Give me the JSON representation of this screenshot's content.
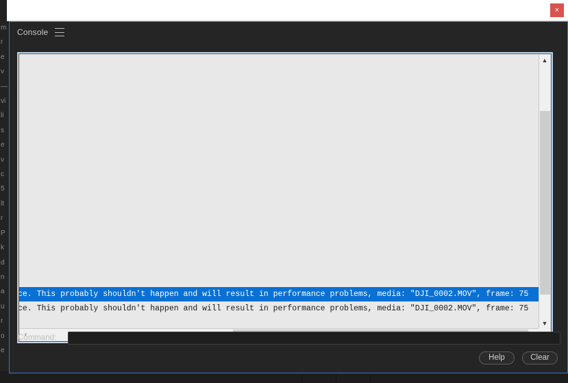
{
  "window": {
    "close_label": "×"
  },
  "panel": {
    "title": "Console",
    "menu_icon": "hamburger-menu-icon"
  },
  "log": {
    "lines": [
      {
        "text": "ce. This probably shouldn't happen and will result in performance problems, media: \"DJI_0002.MOV\", frame: 75",
        "selected": true
      },
      {
        "text": "ce. This probably shouldn't happen and will result in performance problems, media: \"DJI_0002.MOV\", frame: 75",
        "selected": false
      }
    ],
    "scroll_up_icon": "▲",
    "scroll_down_icon": "▼",
    "scroll_left_icon": "‹",
    "scroll_right_icon": "›",
    "selection_color": "#0a70d4",
    "background_color": "#e8e8e8"
  },
  "command": {
    "label": "Command:",
    "value": "",
    "placeholder": ""
  },
  "footer": {
    "help_label": "Help",
    "clear_label": "Clear"
  },
  "backdrop": {
    "left_fragments": "m\nr\ne\nv\n—\nvi\nli\n\ns\ne\nv\nc\n5\nlt\nr\nP\nk\nd\nn\na\nu\nr\no\ne"
  }
}
